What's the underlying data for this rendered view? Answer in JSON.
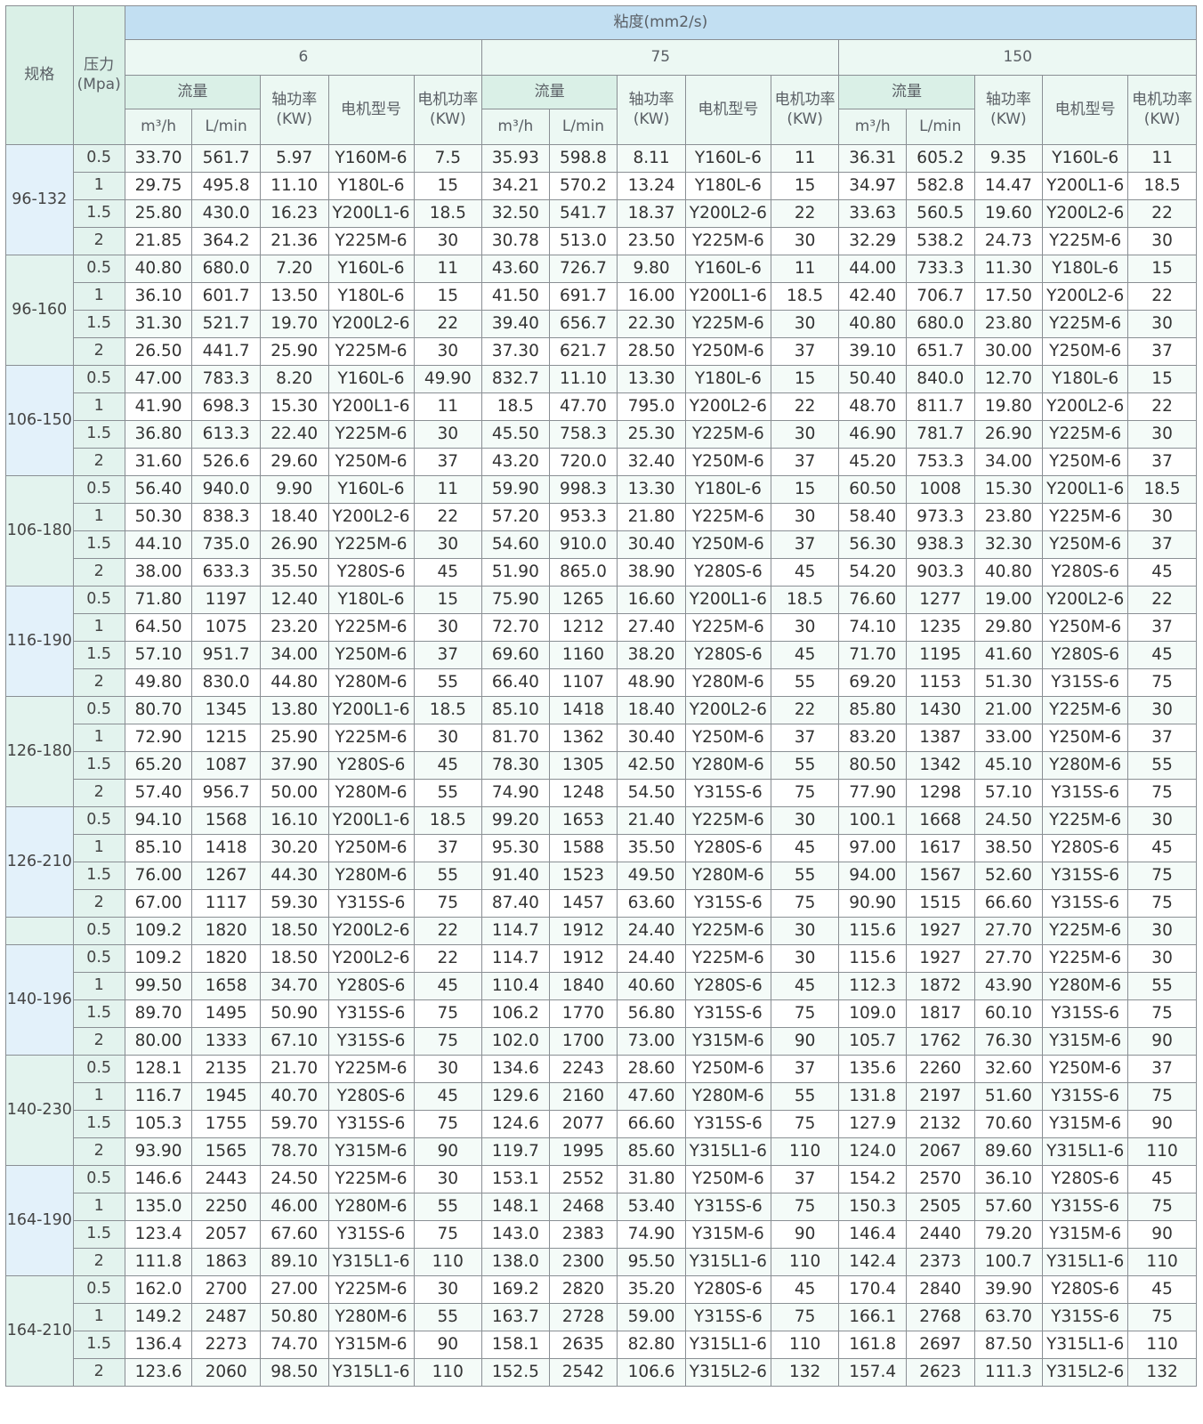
{
  "header": {
    "spec_label": "规格",
    "pressure_label": "压力",
    "pressure_unit": "(Mpa)",
    "viscosity_label": "粘度(mm2/s)",
    "viscosity_values": [
      "6",
      "75",
      "150"
    ],
    "flow_label": "流量",
    "shaft_power_label": "轴功率",
    "shaft_power_unit": "(KW)",
    "motor_model_label": "电机型号",
    "motor_power_label": "电机功率",
    "motor_power_unit": "(KW)",
    "flow_unit_m3h": "m³/h",
    "flow_unit_lmin": "L/min"
  },
  "groups": [
    {
      "spec": "96-132",
      "rows": [
        [
          "0.5",
          "33.70",
          "561.7",
          "5.97",
          "Y160M-6",
          "7.5",
          "35.93",
          "598.8",
          "8.11",
          "Y160L-6",
          "11",
          "36.31",
          "605.2",
          "9.35",
          "Y160L-6",
          "11"
        ],
        [
          "1",
          "29.75",
          "495.8",
          "11.10",
          "Y180L-6",
          "15",
          "34.21",
          "570.2",
          "13.24",
          "Y180L-6",
          "15",
          "34.97",
          "582.8",
          "14.47",
          "Y200L1-6",
          "18.5"
        ],
        [
          "1.5",
          "25.80",
          "430.0",
          "16.23",
          "Y200L1-6",
          "18.5",
          "32.50",
          "541.7",
          "18.37",
          "Y200L2-6",
          "22",
          "33.63",
          "560.5",
          "19.60",
          "Y200L2-6",
          "22"
        ],
        [
          "2",
          "21.85",
          "364.2",
          "21.36",
          "Y225M-6",
          "30",
          "30.78",
          "513.0",
          "23.50",
          "Y225M-6",
          "30",
          "32.29",
          "538.2",
          "24.73",
          "Y225M-6",
          "30"
        ]
      ]
    },
    {
      "spec": "96-160",
      "rows": [
        [
          "0.5",
          "40.80",
          "680.0",
          "7.20",
          "Y160L-6",
          "11",
          "43.60",
          "726.7",
          "9.80",
          "Y160L-6",
          "11",
          "44.00",
          "733.3",
          "11.30",
          "Y180L-6",
          "15"
        ],
        [
          "1",
          "36.10",
          "601.7",
          "13.50",
          "Y180L-6",
          "15",
          "41.50",
          "691.7",
          "16.00",
          "Y200L1-6",
          "18.5",
          "42.40",
          "706.7",
          "17.50",
          "Y200L2-6",
          "22"
        ],
        [
          "1.5",
          "31.30",
          "521.7",
          "19.70",
          "Y200L2-6",
          "22",
          "39.40",
          "656.7",
          "22.30",
          "Y225M-6",
          "30",
          "40.80",
          "680.0",
          "23.80",
          "Y225M-6",
          "30"
        ],
        [
          "2",
          "26.50",
          "441.7",
          "25.90",
          "Y225M-6",
          "30",
          "37.30",
          "621.7",
          "28.50",
          "Y250M-6",
          "37",
          "39.10",
          "651.7",
          "30.00",
          "Y250M-6",
          "37"
        ]
      ]
    },
    {
      "spec": "106-150",
      "rows": [
        [
          "0.5",
          "47.00",
          "783.3",
          "8.20",
          "Y160L-6",
          "49.90",
          "832.7",
          "11.10",
          "13.30",
          "Y180L-6",
          "15",
          "50.40",
          "840.0",
          "12.70",
          "Y180L-6",
          "15"
        ],
        [
          "1",
          "41.90",
          "698.3",
          "15.30",
          "Y200L1-6",
          "11",
          "18.5",
          "47.70",
          "795.0",
          "Y200L2-6",
          "22",
          "48.70",
          "811.7",
          "19.80",
          "Y200L2-6",
          "22"
        ],
        [
          "1.5",
          "36.80",
          "613.3",
          "22.40",
          "Y225M-6",
          "30",
          "45.50",
          "758.3",
          "25.30",
          "Y225M-6",
          "30",
          "46.90",
          "781.7",
          "26.90",
          "Y225M-6",
          "30"
        ],
        [
          "2",
          "31.60",
          "526.6",
          "29.60",
          "Y250M-6",
          "37",
          "43.20",
          "720.0",
          "32.40",
          "Y250M-6",
          "37",
          "45.20",
          "753.3",
          "34.00",
          "Y250M-6",
          "37"
        ]
      ]
    },
    {
      "spec": "106-180",
      "rows": [
        [
          "0.5",
          "56.40",
          "940.0",
          "9.90",
          "Y160L-6",
          "11",
          "59.90",
          "998.3",
          "13.30",
          "Y180L-6",
          "15",
          "60.50",
          "1008",
          "15.30",
          "Y200L1-6",
          "18.5"
        ],
        [
          "1",
          "50.30",
          "838.3",
          "18.40",
          "Y200L2-6",
          "22",
          "57.20",
          "953.3",
          "21.80",
          "Y225M-6",
          "30",
          "58.40",
          "973.3",
          "23.80",
          "Y225M-6",
          "30"
        ],
        [
          "1.5",
          "44.10",
          "735.0",
          "26.90",
          "Y225M-6",
          "30",
          "54.60",
          "910.0",
          "30.40",
          "Y250M-6",
          "37",
          "56.30",
          "938.3",
          "32.30",
          "Y250M-6",
          "37"
        ],
        [
          "2",
          "38.00",
          "633.3",
          "35.50",
          "Y280S-6",
          "45",
          "51.90",
          "865.0",
          "38.90",
          "Y280S-6",
          "45",
          "54.20",
          "903.3",
          "40.80",
          "Y280S-6",
          "45"
        ]
      ]
    },
    {
      "spec": "116-190",
      "rows": [
        [
          "0.5",
          "71.80",
          "1197",
          "12.40",
          "Y180L-6",
          "15",
          "75.90",
          "1265",
          "16.60",
          "Y200L1-6",
          "18.5",
          "76.60",
          "1277",
          "19.00",
          "Y200L2-6",
          "22"
        ],
        [
          "1",
          "64.50",
          "1075",
          "23.20",
          "Y225M-6",
          "30",
          "72.70",
          "1212",
          "27.40",
          "Y225M-6",
          "30",
          "74.10",
          "1235",
          "29.80",
          "Y250M-6",
          "37"
        ],
        [
          "1.5",
          "57.10",
          "951.7",
          "34.00",
          "Y250M-6",
          "37",
          "69.60",
          "1160",
          "38.20",
          "Y280S-6",
          "45",
          "71.70",
          "1195",
          "41.60",
          "Y280S-6",
          "45"
        ],
        [
          "2",
          "49.80",
          "830.0",
          "44.80",
          "Y280M-6",
          "55",
          "66.40",
          "1107",
          "48.90",
          "Y280M-6",
          "55",
          "69.20",
          "1153",
          "51.30",
          "Y315S-6",
          "75"
        ]
      ]
    },
    {
      "spec": "126-180",
      "rows": [
        [
          "0.5",
          "80.70",
          "1345",
          "13.80",
          "Y200L1-6",
          "18.5",
          "85.10",
          "1418",
          "18.40",
          "Y200L2-6",
          "22",
          "85.80",
          "1430",
          "21.00",
          "Y225M-6",
          "30"
        ],
        [
          "1",
          "72.90",
          "1215",
          "25.90",
          "Y225M-6",
          "30",
          "81.70",
          "1362",
          "30.40",
          "Y250M-6",
          "37",
          "83.20",
          "1387",
          "33.00",
          "Y250M-6",
          "37"
        ],
        [
          "1.5",
          "65.20",
          "1087",
          "37.90",
          "Y280S-6",
          "45",
          "78.30",
          "1305",
          "42.50",
          "Y280M-6",
          "55",
          "80.50",
          "1342",
          "45.10",
          "Y280M-6",
          "55"
        ],
        [
          "2",
          "57.40",
          "956.7",
          "50.00",
          "Y280M-6",
          "55",
          "74.90",
          "1248",
          "54.50",
          "Y315S-6",
          "75",
          "77.90",
          "1298",
          "57.10",
          "Y315S-6",
          "75"
        ]
      ]
    },
    {
      "spec": "126-210",
      "rows": [
        [
          "0.5",
          "94.10",
          "1568",
          "16.10",
          "Y200L1-6",
          "18.5",
          "99.20",
          "1653",
          "21.40",
          "Y225M-6",
          "30",
          "100.1",
          "1668",
          "24.50",
          "Y225M-6",
          "30"
        ],
        [
          "1",
          "85.10",
          "1418",
          "30.20",
          "Y250M-6",
          "37",
          "95.30",
          "1588",
          "35.50",
          "Y280S-6",
          "45",
          "97.00",
          "1617",
          "38.50",
          "Y280S-6",
          "45"
        ],
        [
          "1.5",
          "76.00",
          "1267",
          "44.30",
          "Y280M-6",
          "55",
          "91.40",
          "1523",
          "49.50",
          "Y280M-6",
          "55",
          "94.00",
          "1567",
          "52.60",
          "Y315S-6",
          "75"
        ],
        [
          "2",
          "67.00",
          "1117",
          "59.30",
          "Y315S-6",
          "75",
          "87.40",
          "1457",
          "63.60",
          "Y315S-6",
          "75",
          "90.90",
          "1515",
          "66.60",
          "Y315S-6",
          "75"
        ]
      ]
    },
    {
      "spec": "",
      "rows": [
        [
          "0.5",
          "109.2",
          "1820",
          "18.50",
          "Y200L2-6",
          "22",
          "114.7",
          "1912",
          "24.40",
          "Y225M-6",
          "30",
          "115.6",
          "1927",
          "27.70",
          "Y225M-6",
          "30"
        ]
      ]
    },
    {
      "spec": "140-196",
      "rows": [
        [
          "0.5",
          "109.2",
          "1820",
          "18.50",
          "Y200L2-6",
          "22",
          "114.7",
          "1912",
          "24.40",
          "Y225M-6",
          "30",
          "115.6",
          "1927",
          "27.70",
          "Y225M-6",
          "30"
        ],
        [
          "1",
          "99.50",
          "1658",
          "34.70",
          "Y280S-6",
          "45",
          "110.4",
          "1840",
          "40.60",
          "Y280S-6",
          "45",
          "112.3",
          "1872",
          "43.90",
          "Y280M-6",
          "55"
        ],
        [
          "1.5",
          "89.70",
          "1495",
          "50.90",
          "Y315S-6",
          "75",
          "106.2",
          "1770",
          "56.80",
          "Y315S-6",
          "75",
          "109.0",
          "1817",
          "60.10",
          "Y315S-6",
          "75"
        ],
        [
          "2",
          "80.00",
          "1333",
          "67.10",
          "Y315S-6",
          "75",
          "102.0",
          "1700",
          "73.00",
          "Y315M-6",
          "90",
          "105.7",
          "1762",
          "76.30",
          "Y315M-6",
          "90"
        ]
      ]
    },
    {
      "spec": "140-230",
      "rows": [
        [
          "0.5",
          "128.1",
          "2135",
          "21.70",
          "Y225M-6",
          "30",
          "134.6",
          "2243",
          "28.60",
          "Y250M-6",
          "37",
          "135.6",
          "2260",
          "32.60",
          "Y250M-6",
          "37"
        ],
        [
          "1",
          "116.7",
          "1945",
          "40.70",
          "Y280S-6",
          "45",
          "129.6",
          "2160",
          "47.60",
          "Y280M-6",
          "55",
          "131.8",
          "2197",
          "51.60",
          "Y315S-6",
          "75"
        ],
        [
          "1.5",
          "105.3",
          "1755",
          "59.70",
          "Y315S-6",
          "75",
          "124.6",
          "2077",
          "66.60",
          "Y315S-6",
          "75",
          "127.9",
          "2132",
          "70.60",
          "Y315M-6",
          "90"
        ],
        [
          "2",
          "93.90",
          "1565",
          "78.70",
          "Y315M-6",
          "90",
          "119.7",
          "1995",
          "85.60",
          "Y315L1-6",
          "110",
          "124.0",
          "2067",
          "89.60",
          "Y315L1-6",
          "110"
        ]
      ]
    },
    {
      "spec": "164-190",
      "rows": [
        [
          "0.5",
          "146.6",
          "2443",
          "24.50",
          "Y225M-6",
          "30",
          "153.1",
          "2552",
          "31.80",
          "Y250M-6",
          "37",
          "154.2",
          "2570",
          "36.10",
          "Y280S-6",
          "45"
        ],
        [
          "1",
          "135.0",
          "2250",
          "46.00",
          "Y280M-6",
          "55",
          "148.1",
          "2468",
          "53.40",
          "Y315S-6",
          "75",
          "150.3",
          "2505",
          "57.60",
          "Y315S-6",
          "75"
        ],
        [
          "1.5",
          "123.4",
          "2057",
          "67.60",
          "Y315S-6",
          "75",
          "143.0",
          "2383",
          "74.90",
          "Y315M-6",
          "90",
          "146.4",
          "2440",
          "79.20",
          "Y315M-6",
          "90"
        ],
        [
          "2",
          "111.8",
          "1863",
          "89.10",
          "Y315L1-6",
          "110",
          "138.0",
          "2300",
          "95.50",
          "Y315L1-6",
          "110",
          "142.4",
          "2373",
          "100.7",
          "Y315L1-6",
          "110"
        ]
      ]
    },
    {
      "spec": "164-210",
      "rows": [
        [
          "0.5",
          "162.0",
          "2700",
          "27.00",
          "Y225M-6",
          "30",
          "169.2",
          "2820",
          "35.20",
          "Y280S-6",
          "45",
          "170.4",
          "2840",
          "39.90",
          "Y280S-6",
          "45"
        ],
        [
          "1",
          "149.2",
          "2487",
          "50.80",
          "Y280M-6",
          "55",
          "163.7",
          "2728",
          "59.00",
          "Y315S-6",
          "75",
          "166.1",
          "2768",
          "63.70",
          "Y315S-6",
          "75"
        ],
        [
          "1.5",
          "136.4",
          "2273",
          "74.70",
          "Y315M-6",
          "90",
          "158.1",
          "2635",
          "82.80",
          "Y315L1-6",
          "110",
          "161.8",
          "2697",
          "87.50",
          "Y315L1-6",
          "110"
        ],
        [
          "2",
          "123.6",
          "2060",
          "98.50",
          "Y315L1-6",
          "110",
          "152.5",
          "2542",
          "106.6",
          "Y315L2-6",
          "132",
          "157.4",
          "2623",
          "111.3",
          "Y315L2-6",
          "132"
        ]
      ]
    }
  ]
}
